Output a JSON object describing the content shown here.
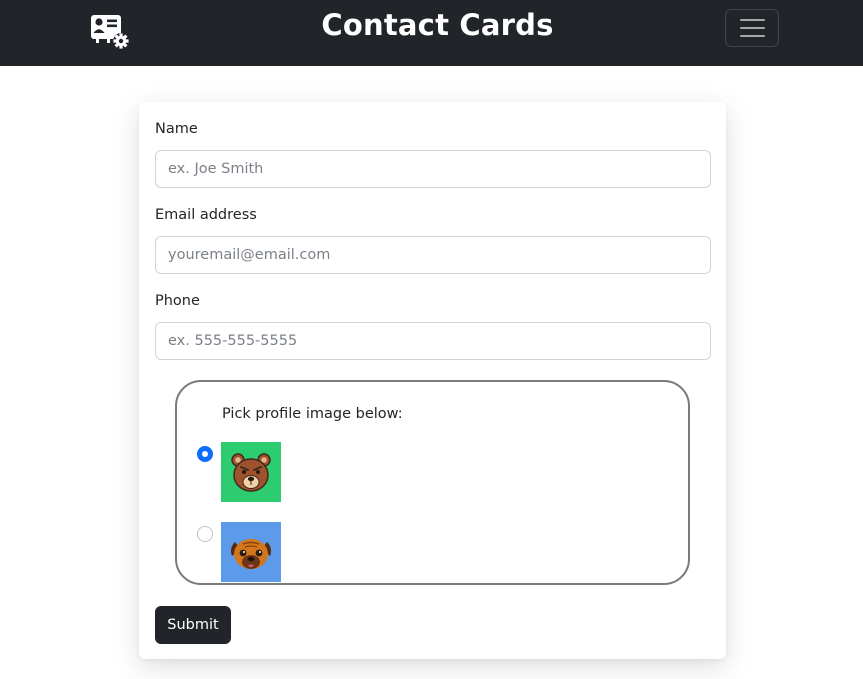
{
  "navbar": {
    "title": "Contact Cards",
    "logo_icon": "contact-card-gear-icon",
    "menu_icon": "hamburger-icon",
    "background": "#212529"
  },
  "form": {
    "name": {
      "label": "Name",
      "placeholder": "ex. Joe Smith",
      "value": ""
    },
    "email": {
      "label": "Email address",
      "placeholder": "youremail@email.com",
      "value": ""
    },
    "phone": {
      "label": "Phone",
      "placeholder": "ex. 555-555-5555",
      "value": ""
    },
    "image_picker": {
      "label": "Pick profile image below:",
      "options": [
        {
          "icon": "bear-icon",
          "background": "#2ecc71",
          "selected": true
        },
        {
          "icon": "pug-dog-icon",
          "background": "#5b9bea",
          "selected": false
        }
      ]
    },
    "submit_label": "Submit"
  },
  "colors": {
    "accent": "#0d6efd",
    "button": "#212529"
  }
}
